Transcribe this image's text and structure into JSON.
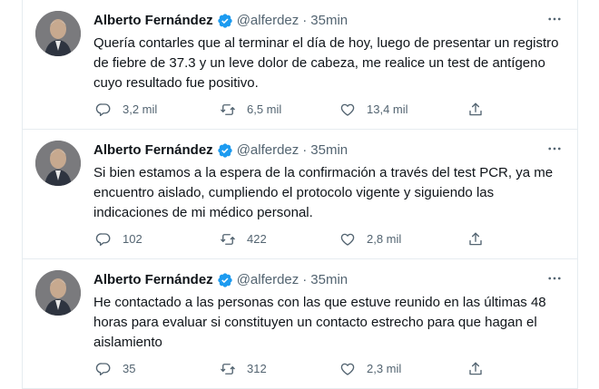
{
  "tweets": [
    {
      "author": "Alberto Fernández",
      "handle": "@alferdez",
      "separator": "·",
      "time": "35min",
      "text": "Quería contarles que al terminar el día de hoy, luego de presentar un registro de fiebre de 37.3 y un leve dolor de cabeza, me realice un test de antígeno cuyo resultado fue positivo.",
      "replies": "3,2 mil",
      "retweets": "6,5 mil",
      "likes": "13,4 mil"
    },
    {
      "author": "Alberto Fernández",
      "handle": "@alferdez",
      "separator": "·",
      "time": "35min",
      "text": "Si bien estamos a la espera de la confirmación a través del test PCR, ya me encuentro aislado, cumpliendo el protocolo vigente y siguiendo las indicaciones de mi médico personal.",
      "replies": "102",
      "retweets": "422",
      "likes": "2,8 mil"
    },
    {
      "author": "Alberto Fernández",
      "handle": "@alferdez",
      "separator": "·",
      "time": "35min",
      "text": "He contactado a las personas con las que estuve reunido en las últimas 48 horas para evaluar si constituyen un contacto estrecho para que hagan el aislamiento",
      "replies": "35",
      "retweets": "312",
      "likes": "2,3 mil"
    }
  ],
  "icons": {
    "verified": "verified-badge-icon",
    "more": "more-options-icon",
    "reply": "reply-icon",
    "retweet": "retweet-icon",
    "like": "like-icon",
    "share": "share-icon"
  },
  "colors": {
    "verified": "#1d9bf0",
    "muted": "#536471",
    "text": "#0f1419",
    "divider": "#e6ecf0"
  }
}
